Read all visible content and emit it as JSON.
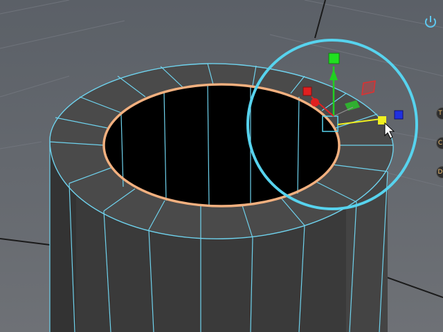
{
  "viewport": {
    "background_color": "#5d6168",
    "mesh": {
      "object": "hollow cylinder",
      "wire_color": "#6fd3ee",
      "selected_edge_loop_color": "#f2b07f",
      "side_face_color": "#3c3c3c",
      "rim_face_color": "#4a4a4a",
      "inner_color": "#000000"
    },
    "manipulator": {
      "type": "combined move / rotate / scale manipulator",
      "rotate_ring_color": "#57d3ee",
      "x_axis_color": "#e02020",
      "y_axis_color": "#20d020",
      "z_axis_color": "#2030e0",
      "selected_handle_color": "#f0f020"
    },
    "cursor": "arrow-cursor"
  },
  "toolbar": {
    "power_icon": "power-icon"
  },
  "side_buttons": [
    {
      "icon": "side-button-icon",
      "label": "T"
    },
    {
      "icon": "side-button-icon",
      "label": "C"
    },
    {
      "icon": "side-button-icon",
      "label": "D"
    }
  ]
}
